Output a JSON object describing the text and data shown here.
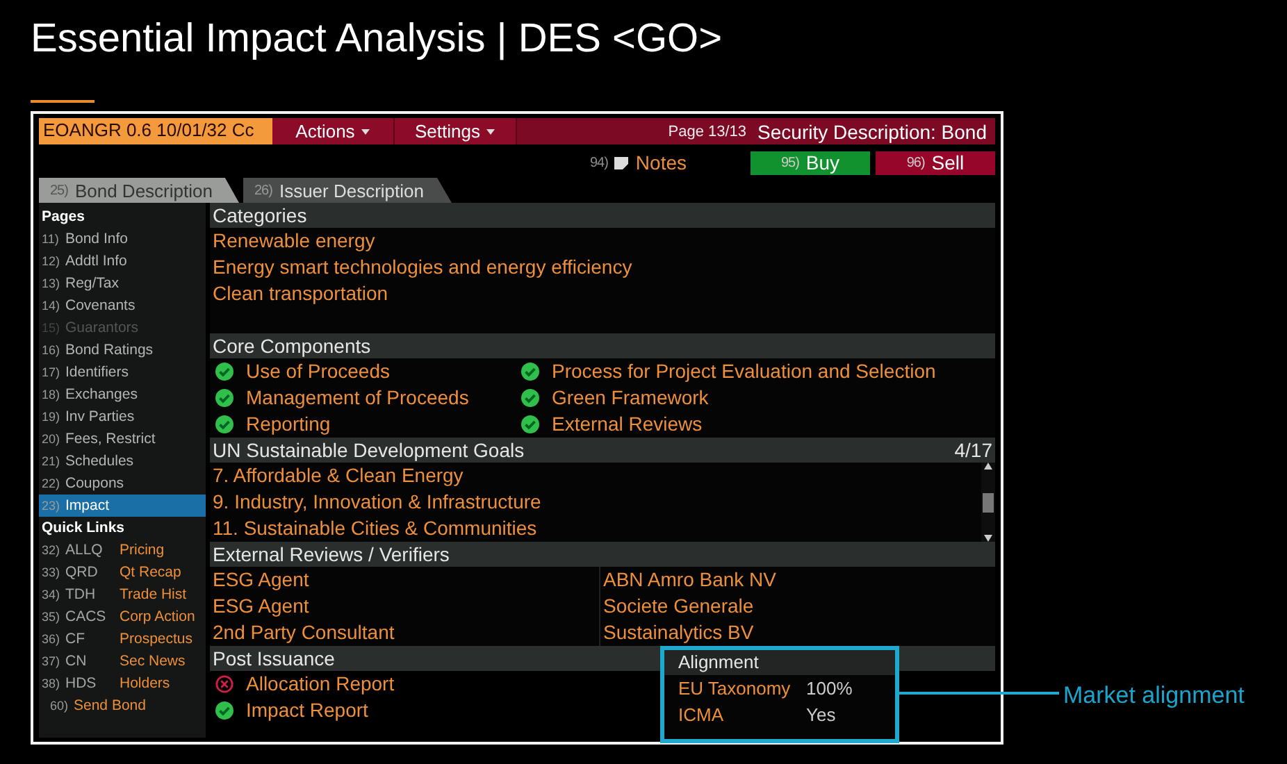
{
  "title": "Essential Impact Analysis | DES <GO>",
  "terminal": {
    "ticker": "EOANGR 0.6 10/01/32 Cc",
    "menus": [
      "Actions",
      "Settings"
    ],
    "page": "Page 13/13",
    "screen_title": "Security Description: Bond",
    "notes": {
      "code": "94)",
      "label": "Notes"
    },
    "actions": [
      {
        "code": "95)",
        "label": "Buy",
        "kind": "buy"
      },
      {
        "code": "96)",
        "label": "Sell",
        "kind": "sell"
      }
    ],
    "tabs": [
      {
        "code": "25)",
        "label": "Bond Description",
        "selected": true
      },
      {
        "code": "26)",
        "label": "Issuer Description",
        "selected": false
      }
    ],
    "sidebar": {
      "pages_heading": "Pages",
      "pages": [
        {
          "code": "11)",
          "label": "Bond Info",
          "disabled": false,
          "selected": false
        },
        {
          "code": "12)",
          "label": "Addtl Info",
          "disabled": false,
          "selected": false
        },
        {
          "code": "13)",
          "label": "Reg/Tax",
          "disabled": false,
          "selected": false
        },
        {
          "code": "14)",
          "label": "Covenants",
          "disabled": false,
          "selected": false
        },
        {
          "code": "15)",
          "label": "Guarantors",
          "disabled": true,
          "selected": false
        },
        {
          "code": "16)",
          "label": "Bond Ratings",
          "disabled": false,
          "selected": false
        },
        {
          "code": "17)",
          "label": "Identifiers",
          "disabled": false,
          "selected": false
        },
        {
          "code": "18)",
          "label": "Exchanges",
          "disabled": false,
          "selected": false
        },
        {
          "code": "19)",
          "label": "Inv Parties",
          "disabled": false,
          "selected": false
        },
        {
          "code": "20)",
          "label": "Fees, Restrict",
          "disabled": false,
          "selected": false
        },
        {
          "code": "21)",
          "label": "Schedules",
          "disabled": false,
          "selected": false
        },
        {
          "code": "22)",
          "label": "Coupons",
          "disabled": false,
          "selected": false
        },
        {
          "code": "23)",
          "label": "Impact",
          "disabled": false,
          "selected": true
        }
      ],
      "links_heading": "Quick Links",
      "links": [
        {
          "code": "32)",
          "mnemonic": "ALLQ",
          "label": "Pricing"
        },
        {
          "code": "33)",
          "mnemonic": "QRD",
          "label": "Qt Recap"
        },
        {
          "code": "34)",
          "mnemonic": "TDH",
          "label": "Trade Hist"
        },
        {
          "code": "35)",
          "mnemonic": "CACS",
          "label": "Corp Action"
        },
        {
          "code": "36)",
          "mnemonic": "CF",
          "label": "Prospectus"
        },
        {
          "code": "37)",
          "mnemonic": "CN",
          "label": "Sec News"
        },
        {
          "code": "38)",
          "mnemonic": "HDS",
          "label": "Holders"
        }
      ],
      "send": {
        "code": "60)",
        "label": "Send Bond"
      }
    },
    "categories": {
      "heading": "Categories",
      "items": [
        "Renewable energy",
        "Energy smart technologies and energy efficiency",
        "Clean transportation"
      ]
    },
    "core_components": {
      "heading": "Core Components",
      "items": [
        {
          "label": "Use of Proceeds",
          "met": true
        },
        {
          "label": "Management of Proceeds",
          "met": true
        },
        {
          "label": "Reporting",
          "met": true
        },
        {
          "label": "Process for Project Evaluation and Selection",
          "met": true
        },
        {
          "label": "Green Framework",
          "met": true
        },
        {
          "label": "External Reviews",
          "met": true
        }
      ]
    },
    "sdgs": {
      "heading": "UN Sustainable Development Goals",
      "counter": "4/17",
      "items": [
        "7. Affordable & Clean Energy",
        "9. Industry, Innovation & Infrastructure",
        "11. Sustainable Cities & Communities"
      ]
    },
    "external_reviews": {
      "heading": "External Reviews / Verifiers",
      "rows": [
        {
          "type": "ESG Agent",
          "name": "ABN Amro Bank NV"
        },
        {
          "type": "ESG Agent",
          "name": "Societe Generale"
        },
        {
          "type": "2nd Party Consultant",
          "name": "Sustainalytics BV"
        }
      ]
    },
    "post_issuance": {
      "heading": "Post Issuance",
      "items": [
        {
          "label": "Allocation Report",
          "met": false
        },
        {
          "label": "Impact Report",
          "met": true
        }
      ]
    },
    "alignment": {
      "heading": "Alignment",
      "rows": [
        {
          "label": "EU Taxonomy",
          "value": "100%"
        },
        {
          "label": "ICMA",
          "value": "Yes"
        }
      ]
    }
  },
  "callout": "Market alignment"
}
